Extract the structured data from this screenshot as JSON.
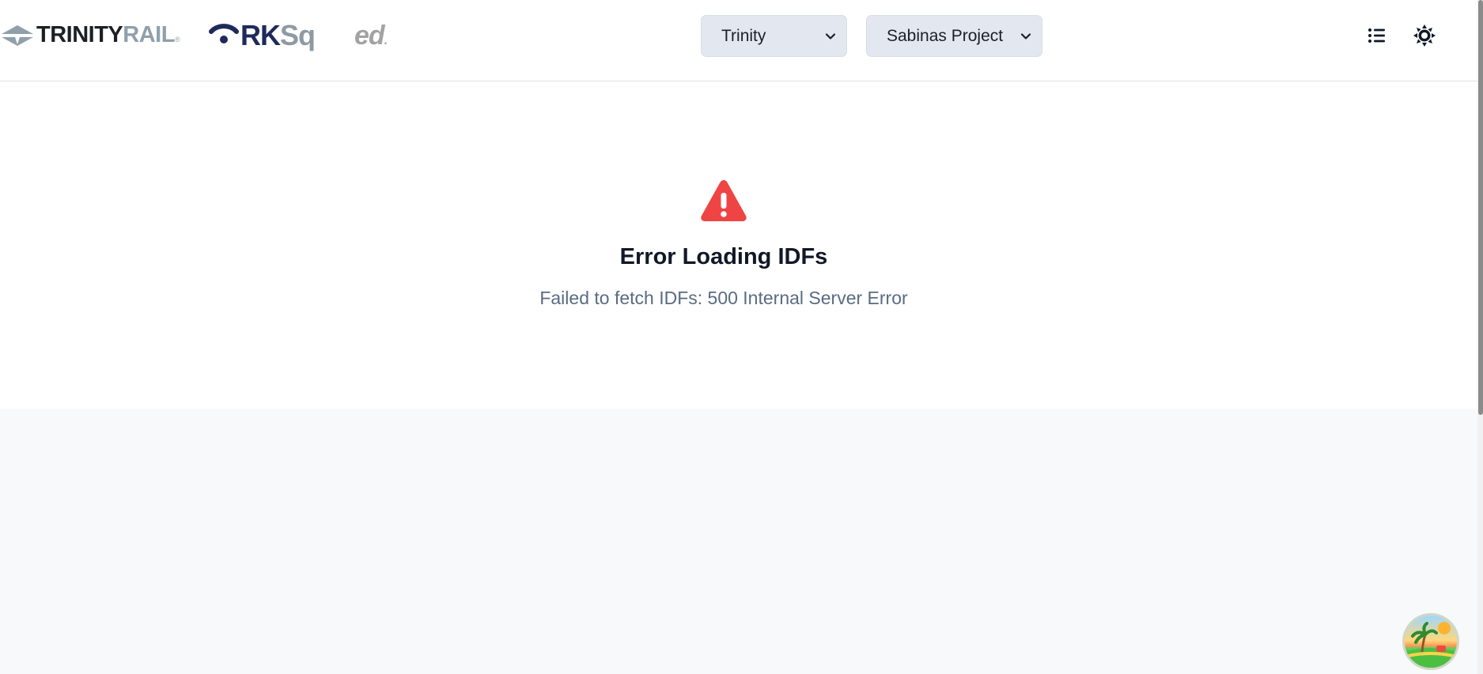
{
  "header": {
    "logos": {
      "trinity": {
        "dark": "TRINITY",
        "grey": "RAIL",
        "mark": "®"
      },
      "rksq": {
        "strong": "RK",
        "light": "Sq"
      },
      "ed": {
        "text": "ed",
        "dot": "."
      }
    },
    "company_select": {
      "value": "Trinity",
      "icon": "chevron-down-icon"
    },
    "project_select": {
      "value": "Sabinas Project",
      "icon": "chevron-down-icon"
    },
    "list_icon": "list-icon",
    "theme_icon": "sun-icon"
  },
  "error": {
    "icon": "warning-triangle-icon",
    "title": "Error Loading IDFs",
    "message": "Failed to fetch IDFs: 500 Internal Server Error",
    "color": "#ef4444"
  },
  "fab": {
    "icon": "island-avatar-icon"
  },
  "colors": {
    "header_bg": "#ffffff",
    "page_bg": "#f8f9fb",
    "select_bg": "#e3e8f0",
    "error_red": "#ef4444",
    "message_grey": "#5a6b82"
  }
}
